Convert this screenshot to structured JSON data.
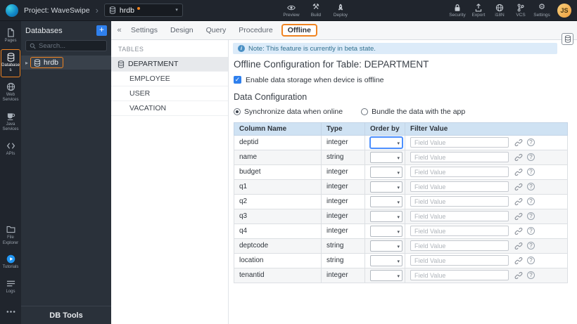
{
  "colors": {
    "accent_orange": "#f08421",
    "accent_blue": "#2f80ed",
    "table_header_bg": "#cfe2f3",
    "note_bg": "#dcebf9"
  },
  "topbar": {
    "project_label": "Project: WaveSwipe",
    "db_selector": "hrdb",
    "actions": [
      {
        "icon": "eye",
        "label": "Preview"
      },
      {
        "icon": "build",
        "label": "Build"
      },
      {
        "icon": "rocket",
        "label": "Deploy"
      }
    ],
    "utilities": [
      {
        "icon": "lock",
        "label": "Security"
      },
      {
        "icon": "export",
        "label": "Export"
      },
      {
        "icon": "globe",
        "label": "i18N"
      },
      {
        "icon": "branch",
        "label": "VCS"
      },
      {
        "icon": "gear",
        "label": "Settings"
      }
    ],
    "avatar": "JS"
  },
  "sidebar": {
    "top": [
      {
        "icon": "pages",
        "label": "Pages",
        "active": false
      },
      {
        "icon": "database",
        "label": "Databases",
        "active": true
      },
      {
        "icon": "globe",
        "label": "Web Services",
        "active": false
      },
      {
        "icon": "cup",
        "label": "Java Services",
        "active": false
      },
      {
        "icon": "api",
        "label": "APIs",
        "active": false
      }
    ],
    "bottom": [
      {
        "icon": "folder",
        "label": "File Explorer",
        "active": false
      },
      {
        "icon": "play",
        "label": "Tutorials",
        "active": false
      },
      {
        "icon": "logs",
        "label": "Logs",
        "active": false
      }
    ]
  },
  "db_panel": {
    "title": "Databases",
    "add_button": "+",
    "search_placeholder": "Search...",
    "tree_items": [
      {
        "label": "hrdb",
        "selected": true
      }
    ],
    "footer_label": "DB Tools"
  },
  "workspace": {
    "tabs": [
      {
        "label": "Settings",
        "active": false
      },
      {
        "label": "Design",
        "active": false
      },
      {
        "label": "Query",
        "active": false
      },
      {
        "label": "Procedure",
        "active": false
      },
      {
        "label": "Offline",
        "active": true
      }
    ],
    "tables_panel": {
      "title": "TABLES",
      "items": [
        {
          "label": "DEPARTMENT",
          "selected": true
        },
        {
          "label": "EMPLOYEE",
          "selected": false
        },
        {
          "label": "USER",
          "selected": false
        },
        {
          "label": "VACATION",
          "selected": false
        }
      ]
    }
  },
  "offline_config": {
    "note": "Note: This feature is currently in beta state.",
    "heading": "Offline Configuration for Table: DEPARTMENT",
    "enable_label": "Enable data storage when device is offline",
    "enable_checked": true,
    "section_title": "Data Configuration",
    "sync_options": [
      {
        "label": "Synchronize data when online",
        "selected": true
      },
      {
        "label": "Bundle the data with the app",
        "selected": false
      }
    ],
    "table": {
      "headers": [
        "Column Name",
        "Type",
        "Order by",
        "Filter Value"
      ],
      "filter_placeholder": "Field Value",
      "rows": [
        {
          "column": "deptid",
          "type": "integer",
          "order_by": "",
          "filter_value": "",
          "focused": true
        },
        {
          "column": "name",
          "type": "string",
          "order_by": "",
          "filter_value": ""
        },
        {
          "column": "budget",
          "type": "integer",
          "order_by": "",
          "filter_value": ""
        },
        {
          "column": "q1",
          "type": "integer",
          "order_by": "",
          "filter_value": ""
        },
        {
          "column": "q2",
          "type": "integer",
          "order_by": "",
          "filter_value": ""
        },
        {
          "column": "q3",
          "type": "integer",
          "order_by": "",
          "filter_value": ""
        },
        {
          "column": "q4",
          "type": "integer",
          "order_by": "",
          "filter_value": ""
        },
        {
          "column": "deptcode",
          "type": "string",
          "order_by": "",
          "filter_value": ""
        },
        {
          "column": "location",
          "type": "string",
          "order_by": "",
          "filter_value": ""
        },
        {
          "column": "tenantid",
          "type": "integer",
          "order_by": "",
          "filter_value": ""
        }
      ]
    }
  }
}
